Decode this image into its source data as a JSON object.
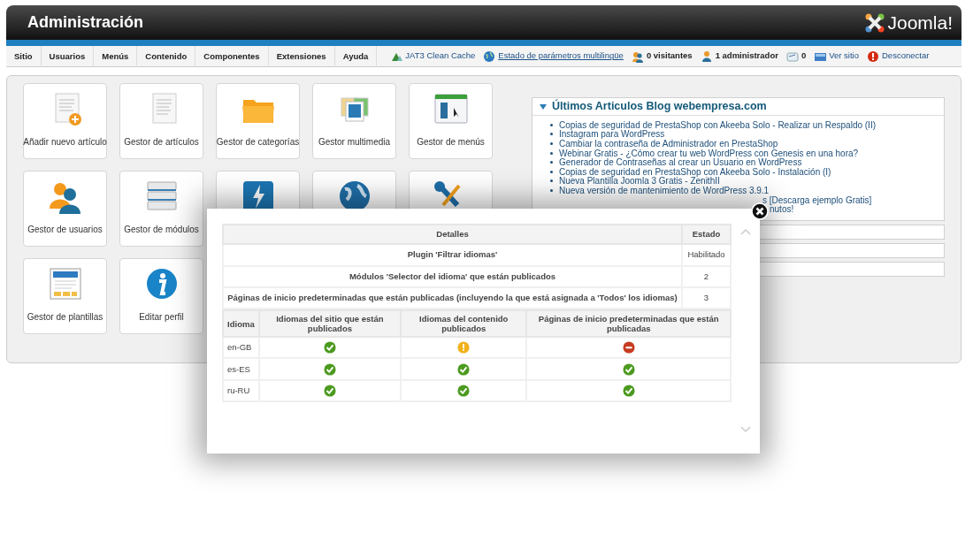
{
  "header": {
    "title": "Administración",
    "logo_text": "Joomla!"
  },
  "menu": [
    {
      "label": "Sitio"
    },
    {
      "label": "Usuarios"
    },
    {
      "label": "Menús"
    },
    {
      "label": "Contenido"
    },
    {
      "label": "Componentes"
    },
    {
      "label": "Extensiones"
    },
    {
      "label": "Ayuda"
    }
  ],
  "status_links": [
    {
      "kind": "cache",
      "label": "JAT3 Clean Cache",
      "underlined": false
    },
    {
      "kind": "globe",
      "label": "Estado de parámetros multilingüe",
      "underlined": true
    },
    {
      "kind": "visitors",
      "label": "0 visitantes",
      "underlined": false
    },
    {
      "kind": "admin",
      "label": "1 administrador",
      "underlined": false
    },
    {
      "kind": "mail",
      "label": "0",
      "underlined": false
    },
    {
      "kind": "screen",
      "label": "Ver sitio",
      "underlined": false
    },
    {
      "kind": "logout",
      "label": "Desconectar",
      "underlined": false
    }
  ],
  "tiles": [
    {
      "kind": "add-article",
      "label": "Añadir nuevo artículo"
    },
    {
      "kind": "articles",
      "label": "Gestor de artículos"
    },
    {
      "kind": "folder",
      "label": "Gestor de categorías"
    },
    {
      "kind": "media",
      "label": "Gestor multimedia"
    },
    {
      "kind": "menus",
      "label": "Gestor de menús"
    },
    {
      "kind": "users",
      "label": "Gestor de usuarios"
    },
    {
      "kind": "modules",
      "label": "Gestor de módulos"
    },
    {
      "kind": "bolt"
    },
    {
      "kind": "globe"
    },
    {
      "kind": "tools"
    },
    {
      "kind": "template",
      "label": "Gestor de plantillas"
    },
    {
      "kind": "info",
      "label": "Editar perfil"
    }
  ],
  "blog": {
    "title": "Últimos Articulos Blog webempresa.com",
    "expanded": true,
    "items": [
      {
        "kind": "full",
        "text": "Copias de seguridad de PrestaShop con Akeeba Solo - Realizar un Respaldo (II)"
      },
      {
        "kind": "full",
        "text": "Instagram para WordPress"
      },
      {
        "kind": "full",
        "text": "Cambiar la contraseña de Administrador en PrestaShop"
      },
      {
        "kind": "full",
        "text": "Webinar Gratis - ¿Cómo crear tu web WordPress con Genesis en una hora?"
      },
      {
        "kind": "full",
        "text": "Generador de Contraseñas al crear un Usuario en WordPress"
      },
      {
        "kind": "full",
        "text": "Copias de seguridad en PrestaShop con Akeeba Solo - Instalación (I)"
      },
      {
        "kind": "full",
        "text": "Nueva Plantilla Joomla 3 Gratis - ZenithII"
      },
      {
        "kind": "full",
        "text": "Nueva versión de mantenimiento de WordPress 3.9.1"
      },
      {
        "kind": "fragment",
        "text": "s [Descarga ejemplo Gratis]"
      },
      {
        "kind": "fragment",
        "text": "nutos!"
      }
    ]
  },
  "modal": {
    "details_table": {
      "columns": [
        "Detalles",
        "Estado"
      ],
      "rows": [
        [
          "Plugin 'Filtrar idiomas'",
          "Habilitado"
        ],
        [
          "Módulos 'Selector del idioma' que están publicados",
          "2"
        ],
        [
          "Páginas de inicio predeterminadas que están publicadas (incluyendo la que está asignada a 'Todos' los idiomas)",
          "3"
        ]
      ]
    },
    "language_table": {
      "columns": [
        "Idioma",
        "Idiomas del sitio que están publicados",
        "Idiomas del contenido publicados",
        "Páginas de inicio predeterminadas que están publicadas"
      ],
      "rows": [
        {
          "language": "en-GB",
          "cells": [
            {
              "kind": "ok"
            },
            {
              "kind": "warning"
            },
            {
              "kind": "error"
            }
          ]
        },
        {
          "language": "es-ES",
          "cells": [
            {
              "kind": "ok"
            },
            {
              "kind": "ok"
            },
            {
              "kind": "ok"
            }
          ]
        },
        {
          "language": "ru-RU",
          "cells": [
            {
              "kind": "ok"
            },
            {
              "kind": "ok"
            },
            {
              "kind": "ok"
            }
          ]
        }
      ]
    }
  }
}
